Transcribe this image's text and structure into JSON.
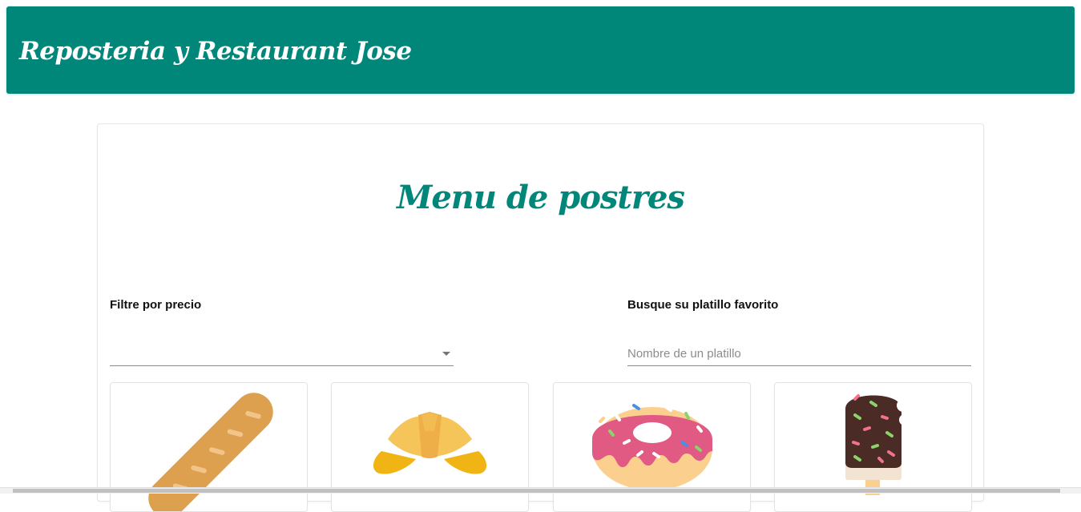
{
  "header": {
    "title": "Reposteria y Restaurant Jose",
    "color": "#00877a"
  },
  "main": {
    "title": "Menu de postres",
    "filter": {
      "label": "Filtre por precio",
      "selected": ""
    },
    "search": {
      "label": "Busque su platillo favorito",
      "placeholder": "Nombre de un platillo",
      "value": ""
    },
    "products": [
      {
        "icon": "baguette-icon"
      },
      {
        "icon": "croissant-icon"
      },
      {
        "icon": "donut-icon"
      },
      {
        "icon": "ice-cream-bar-icon"
      }
    ]
  }
}
